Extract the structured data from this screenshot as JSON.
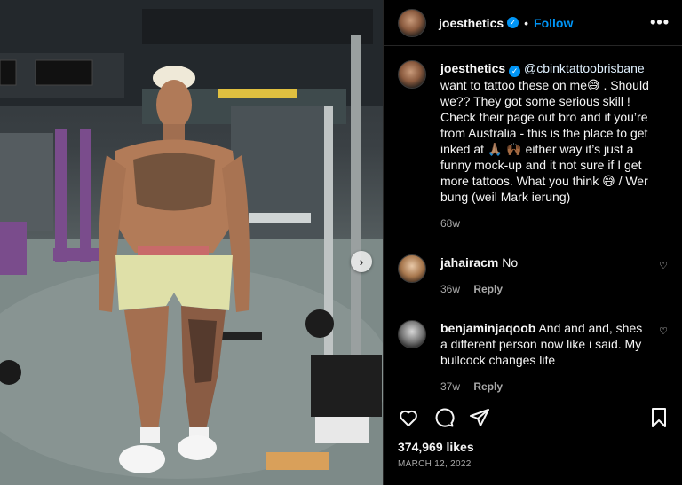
{
  "post": {
    "username": "joesthetics",
    "follow_label": "Follow",
    "more_label": "•••"
  },
  "caption": {
    "username": "joesthetics",
    "mention": "@cbinktattoobrisbane",
    "text": "want to tattoo these on me😅 . Should we?? They got some serious skill ! Check their page out bro and if you’re from Australia - this is the place to get inked at 🙏🏽 🙌🏾 either way it’s just a funny mock-up and it not sure if I get more tattoos. What you think 😅 / Wer bung (weil Mark ierung)",
    "age": "68w"
  },
  "comments": [
    {
      "username": "jahairacm",
      "text": "No",
      "age": "36w",
      "reply_label": "Reply"
    },
    {
      "username": "benjaminjaqoob",
      "text": "And and and, shes a different person now like i said. My bullcock changes life",
      "age": "37w",
      "reply_label": "Reply"
    }
  ],
  "stats": {
    "likes": "374,969 likes",
    "date": "MARCH 12, 2022"
  },
  "icons": {
    "like": "heart-icon",
    "comment": "comment-icon",
    "share": "share-icon",
    "save": "bookmark-icon",
    "next": "chevron-right-icon"
  },
  "colors": {
    "accent": "#0095f6",
    "background": "#000000",
    "secondary_text": "#a8a8a8"
  }
}
